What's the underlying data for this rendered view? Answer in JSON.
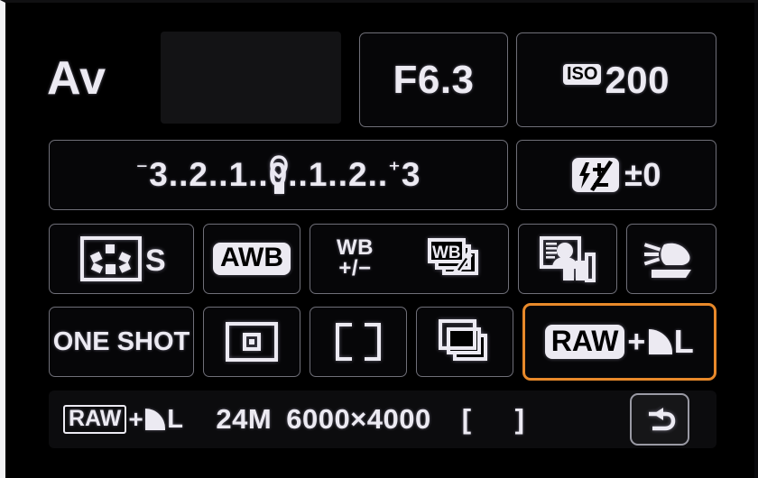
{
  "screen": {
    "device": "camera-quick-control-screen",
    "accent_color": "#e8892a",
    "text_color": "#eceaf2",
    "background_color": "#000000"
  },
  "row1": {
    "shooting_mode": "Av",
    "shutter_speed": "",
    "aperture": "F6.3",
    "iso_label": "ISO",
    "iso_value": "200"
  },
  "row2": {
    "exposure_scale": "⁻3..2..1..0..1..2..⁺3",
    "exposure_scale_parts": {
      "minus_sign": "⁻",
      "minus3": "3",
      "minus2": "2",
      "minus1": "1",
      "zero": "0",
      "plus1": "1",
      "plus2": "2",
      "plus_sign": "⁺",
      "plus3": "3",
      "dots": ".."
    },
    "exposure_compensation_value": "±0",
    "flash_exposure_compensation": "±0",
    "flash_icon_name": "flash-exposure-compensation-icon"
  },
  "row3": [
    {
      "name": "picture-style",
      "icon": "picture-style-icon",
      "label": "S"
    },
    {
      "name": "white-balance",
      "icon": "awb-icon",
      "label": "AWB"
    },
    {
      "name": "white-balance-correction",
      "icon": "wb-shift-icon",
      "label_top": "WB",
      "label_bottom": "+/−"
    },
    {
      "name": "white-balance-bracketing",
      "icon": "wb-bracketing-icon",
      "label": "WB"
    },
    {
      "name": "auto-lighting-optimizer",
      "icon": "auto-lighting-optimizer-icon",
      "label": ""
    },
    {
      "name": "metering-mode",
      "icon": "metering-mode-icon",
      "label": ""
    }
  ],
  "row4": [
    {
      "name": "af-operation",
      "icon": "af-mode-icon",
      "label": "ONE SHOT"
    },
    {
      "name": "metering-spot",
      "icon": "evaluative-metering-icon",
      "label": ""
    },
    {
      "name": "af-area-select",
      "icon": "af-area-bracket-icon",
      "label": ""
    },
    {
      "name": "drive-mode",
      "icon": "continuous-shooting-icon",
      "label": ""
    },
    {
      "name": "image-quality",
      "icon": "raw-quality-icon",
      "raw_label": "RAW",
      "plus": "+",
      "size_label": "L",
      "selected": true
    }
  ],
  "statusbar": {
    "quality_raw": "RAW",
    "quality_plus": "+",
    "quality_size": "L",
    "megapixels": "24M",
    "resolution": "6000×4000",
    "bracket_open": "[",
    "bracket_close": "]",
    "shots_remaining": "",
    "back_button_icon": "return-arrow-icon"
  }
}
